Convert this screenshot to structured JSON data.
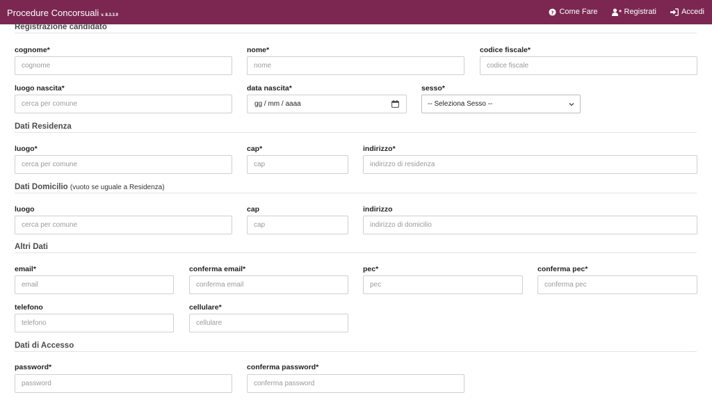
{
  "header": {
    "brand": "Procedure Concorsuali",
    "version": "v. 8.3.3.9",
    "nav": {
      "help": "Come Fare",
      "register": "Registrati",
      "login": "Accedi"
    }
  },
  "sections": {
    "registrazione": "Registrazione candidato",
    "residenza": "Dati Residenza",
    "domicilio": "Dati Domicilio",
    "domicilio_note": "(vuoto se uguale a Residenza)",
    "altri": "Altri Dati",
    "accesso": "Dati di Accesso"
  },
  "registrazione": {
    "cognome": {
      "label": "cognome*",
      "placeholder": "cognome"
    },
    "nome": {
      "label": "nome*",
      "placeholder": "nome"
    },
    "codice_fiscale": {
      "label": "codice fiscale*",
      "placeholder": "codice fiscale"
    },
    "luogo_nascita": {
      "label": "luogo nascita*",
      "placeholder": "cerca per comune"
    },
    "data_nascita": {
      "label": "data nascita*",
      "value": "gg / mm / aaaa"
    },
    "sesso": {
      "label": "sesso*",
      "selected": "-- Seleziona Sesso --"
    }
  },
  "residenza": {
    "luogo": {
      "label": "luogo*",
      "placeholder": "cerca per comune"
    },
    "cap": {
      "label": "cap*",
      "placeholder": "cap"
    },
    "indirizzo": {
      "label": "indirizzo*",
      "placeholder": "indirizzo di residenza"
    }
  },
  "domicilio": {
    "luogo": {
      "label": "luogo",
      "placeholder": "cerca per comune"
    },
    "cap": {
      "label": "cap",
      "placeholder": "cap"
    },
    "indirizzo": {
      "label": "indirizzo",
      "placeholder": "indirizzo di domicilio"
    }
  },
  "altri": {
    "email": {
      "label": "email*",
      "placeholder": "email"
    },
    "conferma_email": {
      "label": "conferma email*",
      "placeholder": "conferma email"
    },
    "pec": {
      "label": "pec*",
      "placeholder": "pec"
    },
    "conferma_pec": {
      "label": "conferma pec*",
      "placeholder": "conferma pec"
    },
    "telefono": {
      "label": "telefono",
      "placeholder": "telefono"
    },
    "cellulare": {
      "label": "cellulare*",
      "placeholder": "cellulare"
    }
  },
  "accesso": {
    "password": {
      "label": "password*",
      "placeholder": "password"
    },
    "conferma_password": {
      "label": "conferma password*",
      "placeholder": "conferma password"
    }
  },
  "colors": {
    "header_bg": "#7b2751",
    "header_text": "#ffffff"
  },
  "icons": {
    "help": "question-circle-icon",
    "register": "user-plus-icon",
    "login": "sign-in-icon",
    "date": "calendar-icon",
    "select": "chevron-down-icon"
  }
}
